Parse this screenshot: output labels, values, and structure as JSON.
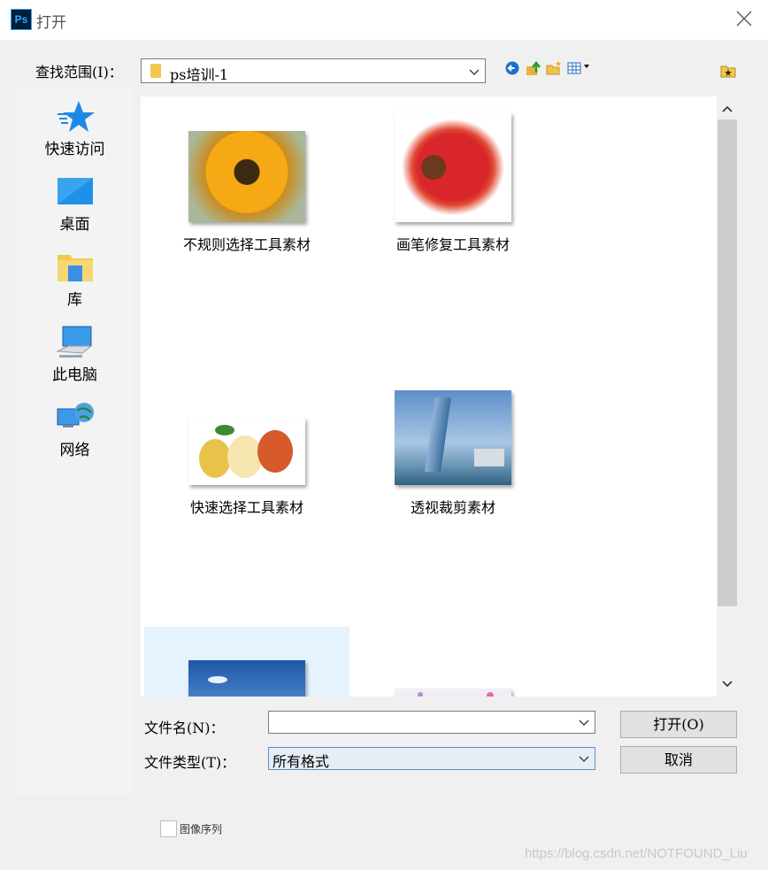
{
  "window": {
    "title": "打开",
    "app_icon_text": "Ps"
  },
  "lookin": {
    "label": "查找范围(I)：",
    "value": "ps培训-1"
  },
  "toolbar": {
    "back_icon": "back-arrow-icon",
    "up_icon": "up-folder-icon",
    "newfolder_icon": "new-folder-icon",
    "view_icon": "view-menu-icon"
  },
  "places": [
    {
      "label": "快速访问",
      "icon": "star-icon"
    },
    {
      "label": "桌面",
      "icon": "desktop-icon"
    },
    {
      "label": "库",
      "icon": "library-icon"
    },
    {
      "label": "此电脑",
      "icon": "computer-icon"
    },
    {
      "label": "网络",
      "icon": "network-icon"
    }
  ],
  "files": [
    {
      "label": "不规则选择工具素材",
      "thumb": "sunflower"
    },
    {
      "label": "画笔修复工具素材",
      "thumb": "apple"
    },
    {
      "label": "快速选择工具素材",
      "thumb": "pears"
    },
    {
      "label": "透视裁剪素材",
      "thumb": "building"
    },
    {
      "label": "",
      "thumb": "sky",
      "selected": true
    },
    {
      "label": "",
      "thumb": "pink"
    }
  ],
  "filename": {
    "label": "文件名(N)：",
    "value": ""
  },
  "filetype": {
    "label": "文件类型(T)：",
    "value": "所有格式"
  },
  "buttons": {
    "open": "打开(O)",
    "cancel": "取消"
  },
  "image_sequence": {
    "label": "图像序列",
    "checked": false
  },
  "watermark": "https://blog.csdn.net/NOTFOUND_Liu"
}
